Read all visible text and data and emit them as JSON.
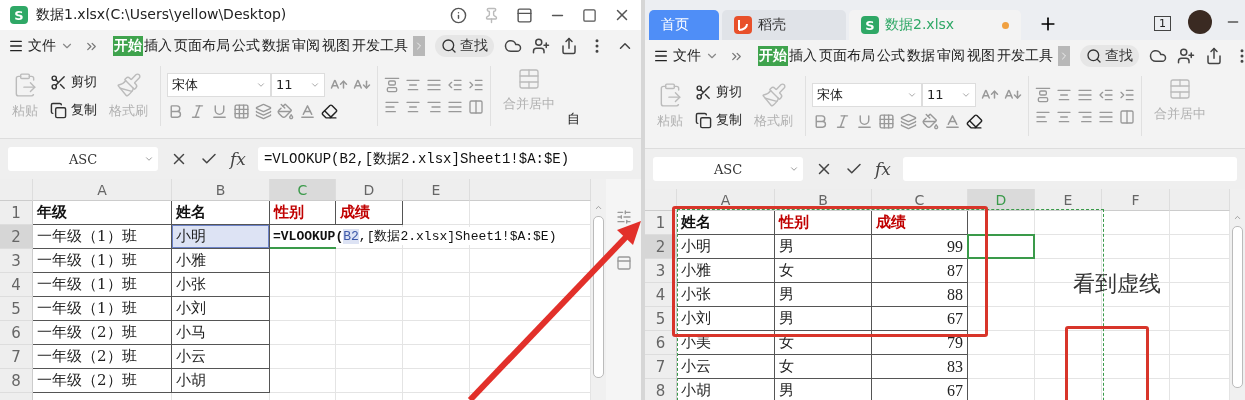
{
  "left_window": {
    "badge": "S",
    "title": "数据1.xlsx(C:\\Users\\yellow\\Desktop)",
    "ribbon": {
      "menu": "文件",
      "tabs": [
        {
          "label": "开始",
          "selected": true
        },
        {
          "label": "插入",
          "selected": false
        },
        {
          "label": "页面布局",
          "selected": false
        },
        {
          "label": "公式",
          "selected": false
        },
        {
          "label": "数据",
          "selected": false
        },
        {
          "label": "审阅",
          "selected": false
        },
        {
          "label": "视图",
          "selected": false
        },
        {
          "label": "开发工具",
          "selected": false
        }
      ],
      "search": "查找",
      "clipboard": [
        {
          "label": "粘贴",
          "kind": "paste",
          "disabled": true
        },
        {
          "label": "剪切",
          "kind": "cut",
          "disabled": false
        },
        {
          "label": "复制",
          "kind": "copy",
          "disabled": false
        },
        {
          "label": "格式刷",
          "kind": "painter",
          "disabled": true
        }
      ],
      "font_name": "宋体",
      "font_size": "11",
      "merge": {
        "label": "合并居中",
        "disabled": true
      },
      "cut_off_label": "自"
    },
    "sheet": {
      "name_box": "ASC",
      "function_label": "fx",
      "formula": "=VLOOKUP(B2,[数据2.xlsx]Sheet1!$A:$E)",
      "columns": [
        {
          "label": "A",
          "selected": false
        },
        {
          "label": "B",
          "selected": false
        },
        {
          "label": "C",
          "selected": true
        },
        {
          "label": "D",
          "selected": false
        },
        {
          "label": "E",
          "selected": false
        }
      ],
      "rows": [
        {
          "number": "1",
          "selected": false,
          "cells": [
            {
              "text": "年级",
              "kind": "bold"
            },
            {
              "text": "姓名",
              "kind": "bold"
            },
            {
              "text": "性别",
              "kind": "red"
            },
            {
              "text": "成绩",
              "kind": "red"
            }
          ]
        },
        {
          "number": "2",
          "selected": true,
          "cells": [
            {
              "text": "一年级（1）班",
              "kind": "text"
            },
            {
              "text": "小明",
              "kind": "referenced"
            },
            {
              "kind": "formula",
              "before": "=VLOOKUP(",
              "ref": "B2",
              "after": ",[数据2.xlsx]Sheet1!$A:$E)"
            }
          ]
        },
        {
          "number": "3",
          "selected": false,
          "cells": [
            {
              "text": "一年级（1）班",
              "kind": "text"
            },
            {
              "text": "小雅",
              "kind": "text"
            }
          ]
        },
        {
          "number": "4",
          "selected": false,
          "cells": [
            {
              "text": "一年级（1）班",
              "kind": "text"
            },
            {
              "text": "小张",
              "kind": "text"
            }
          ]
        },
        {
          "number": "5",
          "selected": false,
          "cells": [
            {
              "text": "一年级（1）班",
              "kind": "text"
            },
            {
              "text": "小刘",
              "kind": "text"
            }
          ]
        },
        {
          "number": "6",
          "selected": false,
          "cells": [
            {
              "text": "一年级（2）班",
              "kind": "text"
            },
            {
              "text": "小马",
              "kind": "text"
            }
          ]
        },
        {
          "number": "7",
          "selected": false,
          "cells": [
            {
              "text": "一年级（2）班",
              "kind": "text"
            },
            {
              "text": "小云",
              "kind": "text"
            }
          ]
        },
        {
          "number": "8",
          "selected": false,
          "cells": [
            {
              "text": "一年级（2）班",
              "kind": "text"
            },
            {
              "text": "小胡",
              "kind": "text"
            }
          ]
        }
      ]
    }
  },
  "right_window": {
    "tabs": [
      {
        "label": "首页",
        "kind": "home",
        "selected": false,
        "unsaved": false
      },
      {
        "label": "稻壳",
        "kind": "docer",
        "selected": false,
        "unsaved": false
      },
      {
        "label": "数据2.xlsx",
        "kind": "sheet",
        "badge": "S",
        "selected": true,
        "unsaved": true
      }
    ],
    "window_count": "1",
    "ribbon": {
      "menu": "文件",
      "tabs": [
        {
          "label": "开始",
          "selected": true
        },
        {
          "label": "插入",
          "selected": false
        },
        {
          "label": "页面布局",
          "selected": false
        },
        {
          "label": "公式",
          "selected": false
        },
        {
          "label": "数据",
          "selected": false
        },
        {
          "label": "审阅",
          "selected": false
        },
        {
          "label": "视图",
          "selected": false
        },
        {
          "label": "开发工具",
          "selected": false
        }
      ],
      "search": "查找",
      "clipboard": [
        {
          "label": "粘贴",
          "kind": "paste",
          "disabled": true
        },
        {
          "label": "剪切",
          "kind": "cut",
          "disabled": false
        },
        {
          "label": "复制",
          "kind": "copy",
          "disabled": false
        },
        {
          "label": "格式刷",
          "kind": "painter",
          "disabled": true
        }
      ],
      "font_name": "宋体",
      "font_size": "11",
      "merge": {
        "label": "合并居中",
        "disabled": true
      }
    },
    "sheet": {
      "name_box": "ASC",
      "function_label": "fx",
      "columns": [
        {
          "label": "A",
          "selected": false
        },
        {
          "label": "B",
          "selected": false
        },
        {
          "label": "C",
          "selected": false
        },
        {
          "label": "D",
          "selected": true
        },
        {
          "label": "E",
          "selected": false
        },
        {
          "label": "F",
          "selected": false
        }
      ],
      "rows": [
        {
          "number": "1",
          "selected": false,
          "cells": [
            {
              "text": "姓名",
              "kind": "bold"
            },
            {
              "text": "性别",
              "kind": "red"
            },
            {
              "text": "成绩",
              "kind": "red"
            }
          ]
        },
        {
          "number": "2",
          "selected": true,
          "cells": [
            {
              "text": "小明",
              "kind": "text"
            },
            {
              "text": "男",
              "kind": "text"
            },
            {
              "text": "99",
              "kind": "number"
            }
          ]
        },
        {
          "number": "3",
          "selected": false,
          "cells": [
            {
              "text": "小雅",
              "kind": "text"
            },
            {
              "text": "女",
              "kind": "text"
            },
            {
              "text": "87",
              "kind": "number"
            }
          ]
        },
        {
          "number": "4",
          "selected": false,
          "cells": [
            {
              "text": "小张",
              "kind": "text"
            },
            {
              "text": "男",
              "kind": "text"
            },
            {
              "text": "88",
              "kind": "number"
            }
          ]
        },
        {
          "number": "5",
          "selected": false,
          "cells": [
            {
              "text": "小刘",
              "kind": "text"
            },
            {
              "text": "男",
              "kind": "text"
            },
            {
              "text": "67",
              "kind": "number"
            }
          ]
        },
        {
          "number": "6",
          "selected": false,
          "cells": [
            {
              "text": "小美",
              "kind": "text"
            },
            {
              "text": "女",
              "kind": "text"
            },
            {
              "text": "79",
              "kind": "number"
            }
          ]
        },
        {
          "number": "7",
          "selected": false,
          "cells": [
            {
              "text": "小云",
              "kind": "text"
            },
            {
              "text": "女",
              "kind": "text"
            },
            {
              "text": "83",
              "kind": "number"
            }
          ]
        },
        {
          "number": "8",
          "selected": false,
          "cells": [
            {
              "text": "小胡",
              "kind": "text"
            },
            {
              "text": "男",
              "kind": "text"
            },
            {
              "text": "67",
              "kind": "number"
            }
          ]
        }
      ]
    },
    "annotation": "看到虚线"
  }
}
